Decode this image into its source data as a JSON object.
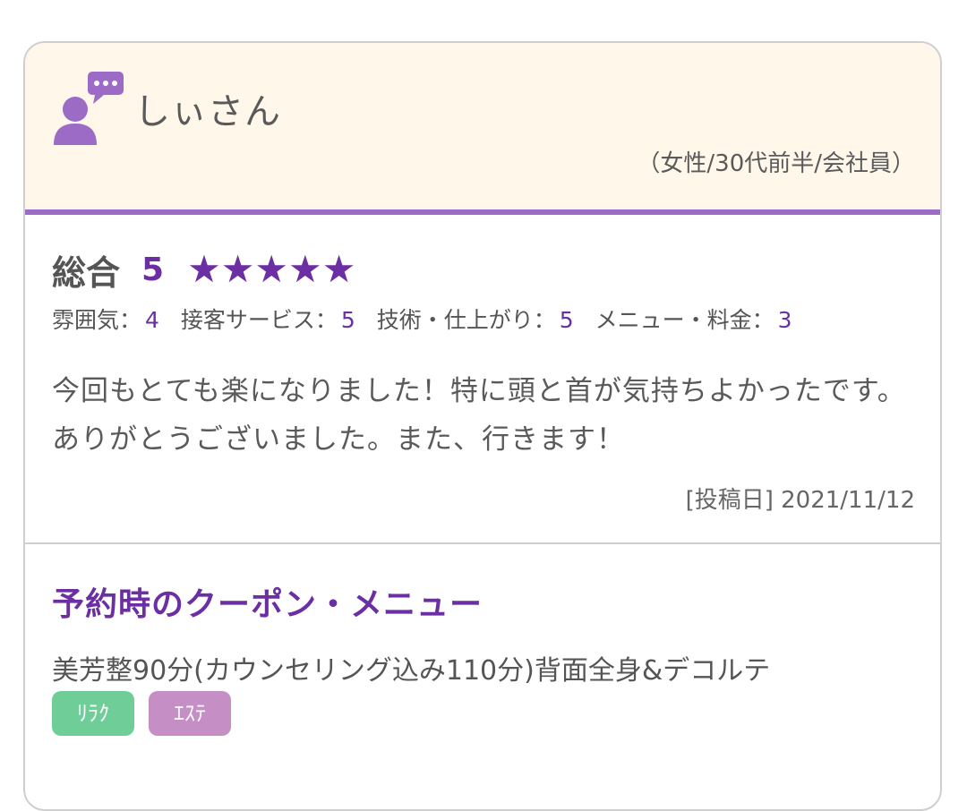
{
  "reviewer": {
    "name": "しぃさん",
    "attributes": "（女性/30代前半/会社員）"
  },
  "rating": {
    "label": "総合",
    "score": "5",
    "stars": 5,
    "accent_color": "#6b2fa3",
    "sub_ratings": [
      {
        "label": "雰囲気：",
        "value": "4"
      },
      {
        "label": "接客サービス：",
        "value": "5"
      },
      {
        "label": "技術・仕上がり：",
        "value": "5"
      },
      {
        "label": "メニュー・料金：",
        "value": "3"
      }
    ]
  },
  "comment": "今回もとても楽になりました！特に頭と首が気持ちよかったです。ありがとうございました。また、行きます！",
  "post_date": "[投稿日] 2021/11/12",
  "coupon": {
    "title": "予約時のクーポン・メニュー",
    "menu": "美芳整90分(カウンセリング込み110分)背面全身&デコルテ",
    "tags": [
      {
        "label": "ﾘﾗｸ",
        "color": "#6fce97"
      },
      {
        "label": "ｴｽﾃ",
        "color": "#c58fc6"
      }
    ]
  },
  "icons": {
    "avatar": "user-speech-icon",
    "star": "star-icon"
  }
}
